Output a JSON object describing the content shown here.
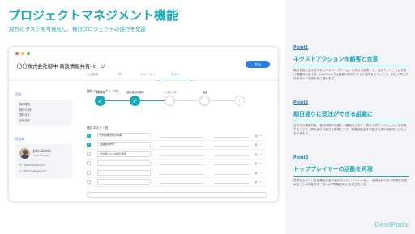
{
  "page": {
    "title": "プロジェクトマネジメント機能",
    "subtitle": "双方のタスクを可視化し、検討プロジェクトの遂行を支援"
  },
  "window": {
    "title": "〇〇株式会社御中 商談情報共有ページ",
    "action_button": "共有",
    "tabs": [
      {
        "label": "会社概要",
        "active": false
      },
      {
        "label": "資料",
        "active": false
      },
      {
        "label": "Q&Aリスト",
        "active": false
      },
      {
        "label": "タスク",
        "active": true
      }
    ]
  },
  "sidebar": {
    "section_label": "目次",
    "items": [
      "検討概要",
      "検討の流れ",
      "資料共有",
      "会議記録"
    ],
    "members_label": "担当者",
    "member": {
      "name": "John Smith",
      "role": "Sales manager",
      "email": "mail123@mail.com",
      "url": "https://mail.ezy.com/"
    }
  },
  "flow": {
    "title": "検討プロジェクト フロー",
    "steps": [
      {
        "label": "情報収集",
        "state": "done"
      },
      {
        "label": "検討事項の確認",
        "state": "done"
      },
      {
        "label": "トライアル",
        "state": "empty"
      },
      {
        "label": "稟議",
        "state": "empty"
      },
      {
        "label": "",
        "state": "dashed"
      }
    ]
  },
  "tasks": {
    "title": "検討タスク一覧",
    "rows": [
      {
        "text": "社内説明資料の準備",
        "checked": true
      },
      {
        "text": "稟議書の作成",
        "checked": true
      },
      {
        "text": "担当者による内容の確認",
        "checked": false
      },
      {
        "text": "",
        "checked": false
      },
      {
        "text": "",
        "checked": false
      },
      {
        "text": "",
        "checked": false
      }
    ]
  },
  "points": [
    {
      "label": "Point1",
      "heading": "ネクストアクションを顧客と合意",
      "text": "商談を前に進めるためにネクストアクションを両社で合意して、進めていくことは非常に重要な行為です。DealPodsでは顧客と共同でタスク管理を行うことで、両社が同じ方向を向いて商談を前に進めます。"
    },
    {
      "label": "Point2",
      "heading": "期日通りに受注ができる組織に",
      "text": "社内での情報共有、受注時期の見通しの確度向上など、両社で同じスケジュールを共有することで、期日通りの受注を実現します。営業組織全体の受注予測の精度向上にもつながります。"
    },
    {
      "label": "Point3",
      "heading": "トッププレイヤーの活動を再現",
      "text": "成果を上げている営業担当者の進め方をテンプレート化し、組織全体でその再現性を高めることが可能です。新人の早期戦力化にも役立ちます。"
    }
  ],
  "brand": "DealPods"
}
